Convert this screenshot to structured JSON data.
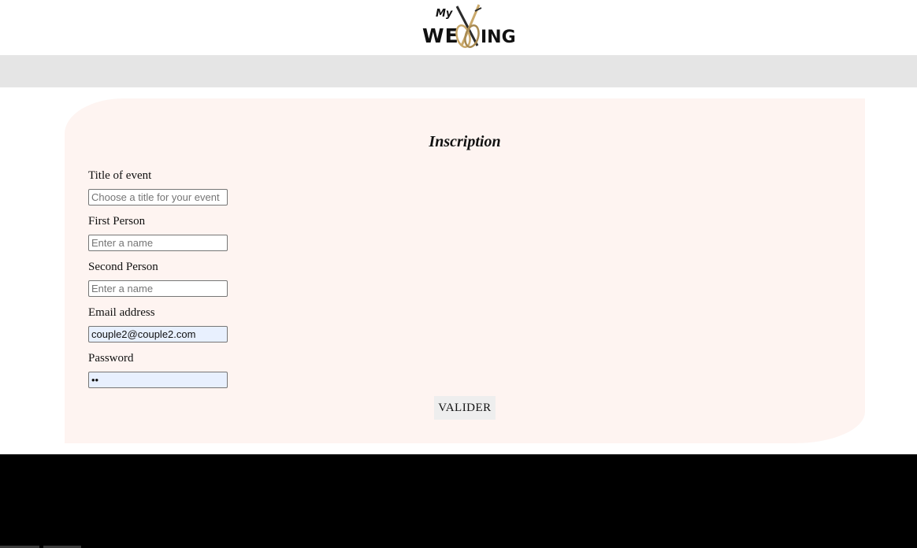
{
  "header": {
    "logo": {
      "prefix": "My",
      "left_text": "WE",
      "right_text": "ING",
      "alt": "My Wedding logo",
      "rings_icon": "rings-icon",
      "accent_color": "#c9a86a"
    }
  },
  "form": {
    "title": "Inscription",
    "fields": [
      {
        "label": "Title of event",
        "placeholder": "Choose a title for your event",
        "value": "",
        "type": "text"
      },
      {
        "label": "First Person",
        "placeholder": "Enter a name",
        "value": "",
        "type": "text"
      },
      {
        "label": "Second Person",
        "placeholder": "Enter a name",
        "value": "",
        "type": "text"
      },
      {
        "label": "Email address",
        "placeholder": "",
        "value": "couple2@couple2.com",
        "type": "email"
      },
      {
        "label": "Password",
        "placeholder": "",
        "value": "••",
        "type": "password"
      }
    ],
    "submit_label": "VALIDER"
  },
  "colors": {
    "nav_bar": "#e5e5e5",
    "card_background": "#fef4f1",
    "autofill_background": "#e8f0fe",
    "button_background": "#eeeeee",
    "footer_background": "#000000"
  }
}
